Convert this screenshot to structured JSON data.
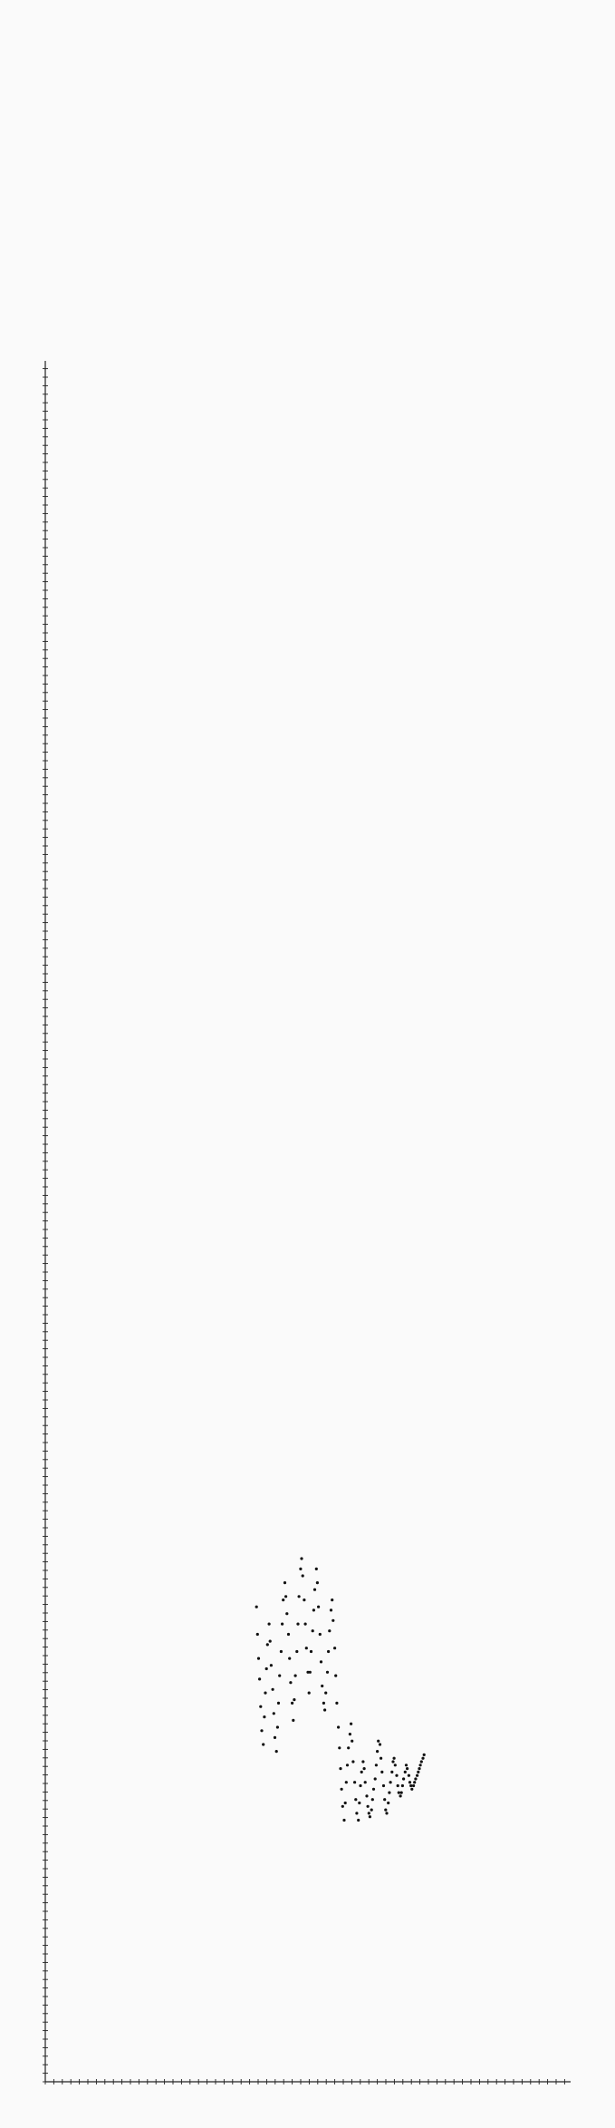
{
  "chart_data": {
    "type": "scatter",
    "title": "",
    "xlabel": "",
    "ylabel": "",
    "xlim": [
      0,
      100
    ],
    "ylim": [
      0,
      100
    ],
    "grid": false,
    "legend": "none",
    "colors": {
      "background": "#fafafa",
      "axis": "#222222",
      "point": "#111111"
    },
    "series": [
      {
        "points": [
          [
            40.2,
            27.6
          ],
          [
            40.4,
            26.0
          ],
          [
            40.6,
            24.6
          ],
          [
            40.8,
            23.4
          ],
          [
            41.0,
            21.8
          ],
          [
            41.2,
            20.4
          ],
          [
            41.5,
            19.6
          ],
          [
            41.7,
            21.2
          ],
          [
            41.9,
            22.6
          ],
          [
            42.1,
            24.0
          ],
          [
            42.3,
            25.4
          ],
          [
            42.6,
            26.6
          ],
          [
            42.8,
            25.6
          ],
          [
            43.0,
            24.2
          ],
          [
            43.3,
            22.8
          ],
          [
            43.5,
            21.4
          ],
          [
            43.7,
            20.0
          ],
          [
            44.0,
            19.2
          ],
          [
            44.2,
            20.6
          ],
          [
            44.4,
            22.0
          ],
          [
            44.6,
            23.6
          ],
          [
            44.9,
            25.0
          ],
          [
            45.1,
            26.6
          ],
          [
            45.3,
            28.0
          ],
          [
            45.6,
            29.0
          ],
          [
            45.8,
            28.2
          ],
          [
            46.0,
            27.2
          ],
          [
            46.3,
            26.0
          ],
          [
            46.5,
            24.6
          ],
          [
            46.7,
            23.2
          ],
          [
            47.0,
            22.0
          ],
          [
            47.2,
            21.0
          ],
          [
            47.4,
            22.2
          ],
          [
            47.6,
            23.6
          ],
          [
            47.9,
            25.0
          ],
          [
            48.1,
            26.6
          ],
          [
            48.3,
            28.2
          ],
          [
            48.6,
            29.8
          ],
          [
            48.8,
            30.4
          ],
          [
            49.0,
            29.4
          ],
          [
            49.3,
            28.0
          ],
          [
            49.5,
            26.6
          ],
          [
            49.7,
            25.2
          ],
          [
            50.0,
            23.8
          ],
          [
            50.2,
            22.6
          ],
          [
            50.4,
            23.8
          ],
          [
            50.6,
            25.0
          ],
          [
            50.9,
            26.2
          ],
          [
            51.1,
            27.4
          ],
          [
            51.3,
            28.6
          ],
          [
            51.6,
            29.8
          ],
          [
            51.8,
            29.0
          ],
          [
            52.0,
            27.6
          ],
          [
            52.3,
            26.0
          ],
          [
            52.5,
            24.4
          ],
          [
            52.7,
            23.0
          ],
          [
            53.0,
            22.0
          ],
          [
            53.2,
            21.6
          ],
          [
            53.4,
            22.6
          ],
          [
            53.7,
            23.8
          ],
          [
            53.9,
            25.0
          ],
          [
            54.1,
            26.2
          ],
          [
            54.4,
            27.4
          ],
          [
            54.6,
            28.0
          ],
          [
            54.8,
            26.8
          ],
          [
            55.1,
            25.2
          ],
          [
            55.3,
            23.6
          ],
          [
            55.5,
            22.0
          ],
          [
            55.8,
            20.6
          ],
          [
            56.0,
            19.4
          ],
          [
            56.2,
            18.2
          ],
          [
            56.4,
            17.0
          ],
          [
            56.6,
            16.0
          ],
          [
            56.9,
            15.2
          ],
          [
            57.1,
            16.2
          ],
          [
            57.3,
            17.4
          ],
          [
            57.5,
            18.4
          ],
          [
            57.7,
            19.4
          ],
          [
            58.0,
            20.2
          ],
          [
            58.2,
            20.8
          ],
          [
            58.4,
            19.8
          ],
          [
            58.6,
            18.6
          ],
          [
            58.9,
            17.4
          ],
          [
            59.1,
            16.4
          ],
          [
            59.3,
            15.6
          ],
          [
            59.6,
            15.2
          ],
          [
            59.8,
            16.2
          ],
          [
            60.0,
            17.2
          ],
          [
            60.2,
            18.0
          ],
          [
            60.5,
            18.6
          ],
          [
            60.7,
            18.2
          ],
          [
            60.9,
            17.4
          ],
          [
            61.2,
            16.6
          ],
          [
            61.4,
            16.0
          ],
          [
            61.6,
            15.6
          ],
          [
            61.8,
            15.4
          ],
          [
            62.1,
            15.8
          ],
          [
            62.3,
            16.4
          ],
          [
            62.5,
            17.0
          ],
          [
            62.8,
            17.6
          ],
          [
            63.0,
            18.4
          ],
          [
            63.2,
            19.2
          ],
          [
            63.4,
            19.8
          ],
          [
            63.7,
            19.6
          ],
          [
            63.9,
            18.8
          ],
          [
            64.1,
            18.0
          ],
          [
            64.4,
            17.2
          ],
          [
            64.6,
            16.4
          ],
          [
            64.8,
            15.8
          ],
          [
            65.0,
            15.6
          ],
          [
            65.3,
            16.2
          ],
          [
            65.5,
            16.8
          ],
          [
            65.7,
            17.4
          ],
          [
            66.0,
            18.0
          ],
          [
            66.2,
            18.6
          ],
          [
            66.4,
            18.8
          ],
          [
            66.6,
            18.4
          ],
          [
            66.9,
            17.8
          ],
          [
            67.1,
            17.2
          ],
          [
            67.3,
            16.8
          ],
          [
            67.6,
            16.6
          ],
          [
            67.8,
            16.8
          ],
          [
            68.0,
            17.2
          ],
          [
            68.2,
            17.6
          ],
          [
            68.5,
            18.0
          ],
          [
            68.7,
            18.4
          ],
          [
            68.9,
            18.2
          ],
          [
            69.2,
            17.8
          ],
          [
            69.4,
            17.4
          ],
          [
            69.6,
            17.2
          ],
          [
            69.8,
            17.0
          ],
          [
            70.1,
            17.2
          ],
          [
            70.3,
            17.4
          ],
          [
            70.5,
            17.6
          ],
          [
            70.8,
            17.8
          ],
          [
            71.0,
            18.0
          ],
          [
            71.2,
            18.2
          ],
          [
            71.4,
            18.4
          ],
          [
            71.6,
            18.6
          ],
          [
            71.9,
            18.8
          ],
          [
            72.1,
            19.0
          ]
        ]
      }
    ]
  }
}
